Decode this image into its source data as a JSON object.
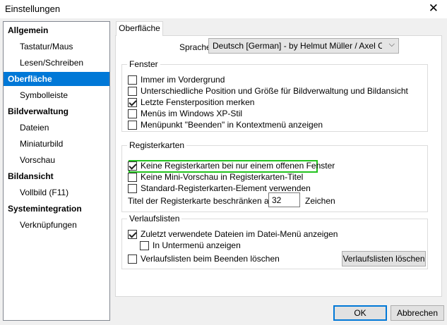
{
  "window": {
    "title": "Einstellungen",
    "close_glyph": "✕"
  },
  "nav": {
    "items": [
      {
        "label": "Allgemein",
        "level": "heading",
        "selected": false
      },
      {
        "label": "Tastatur/Maus",
        "level": "sub",
        "selected": false
      },
      {
        "label": "Lesen/Schreiben",
        "level": "sub",
        "selected": false
      },
      {
        "label": "Oberfläche",
        "level": "heading",
        "selected": true
      },
      {
        "label": "Symbolleiste",
        "level": "sub",
        "selected": false
      },
      {
        "label": "Bildverwaltung",
        "level": "heading",
        "selected": false
      },
      {
        "label": "Dateien",
        "level": "sub",
        "selected": false
      },
      {
        "label": "Miniaturbild",
        "level": "sub",
        "selected": false
      },
      {
        "label": "Vorschau",
        "level": "sub",
        "selected": false
      },
      {
        "label": "Bildansicht",
        "level": "heading",
        "selected": false
      },
      {
        "label": "Vollbild  (F11)",
        "level": "sub",
        "selected": false
      },
      {
        "label": "Systemintegration",
        "level": "heading",
        "selected": false
      },
      {
        "label": "Verknüpfungen",
        "level": "sub",
        "selected": false
      }
    ]
  },
  "tab": {
    "label": "Oberfläche"
  },
  "language": {
    "label": "Sprache",
    "value": "Deutsch [German] - by Helmut Müller / Axel C. Burgbacher",
    "chevron": "⌵"
  },
  "groups": {
    "fenster": {
      "title": "Fenster",
      "options": [
        {
          "label": "Immer im Vordergrund",
          "checked": false
        },
        {
          "label": "Unterschiedliche Position und Größe für Bildverwaltung und Bildansicht",
          "checked": false
        },
        {
          "label": "Letzte Fensterposition merken",
          "checked": true
        },
        {
          "label": "Menüs im Windows XP-Stil",
          "checked": false
        },
        {
          "label": "Menüpunkt \"Beenden\" in Kontextmenü anzeigen",
          "checked": false
        }
      ]
    },
    "registerkarten": {
      "title": "Registerkarten",
      "options": [
        {
          "label": "Keine Registerkarten bei nur einem offenen Fenster",
          "checked": true
        },
        {
          "label": "Keine Mini-Vorschau in Registerkarten-Titel",
          "checked": false
        },
        {
          "label": "Standard-Registerkarten-Element verwenden",
          "checked": false
        }
      ],
      "limit_label": "Titel der Registerkarte beschränken auf",
      "limit_value": "32",
      "limit_unit": "Zeichen"
    },
    "verlaufslisten": {
      "title": "Verlaufslisten",
      "options": [
        {
          "label": "Zuletzt verwendete Dateien im Datei-Menü anzeigen",
          "checked": true
        },
        {
          "label": "In Untermenü anzeigen",
          "checked": false
        },
        {
          "label": "Verlaufslisten beim Beenden löschen",
          "checked": false
        }
      ],
      "clear_button": "Verlaufslisten löschen"
    }
  },
  "buttons": {
    "ok": "OK",
    "cancel": "Abbrechen"
  },
  "colors": {
    "selection": "#0078d7",
    "highlight_box": "#22c21e"
  }
}
